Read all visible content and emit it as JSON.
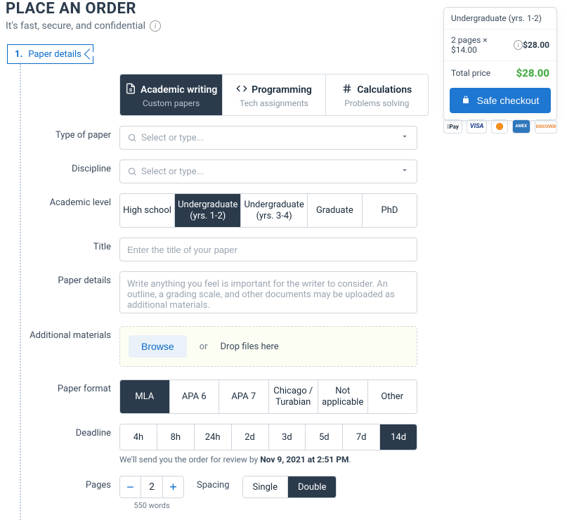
{
  "header": {
    "title": "PLACE AN ORDER",
    "subtitle": "It's fast, secure, and confidential"
  },
  "step": {
    "number": "1.",
    "label": "Paper details"
  },
  "services": [
    {
      "name": "Academic writing",
      "sub": "Custom papers",
      "active": true
    },
    {
      "name": "Programming",
      "sub": "Tech assignments",
      "active": false
    },
    {
      "name": "Calculations",
      "sub": "Problems solving",
      "active": false
    }
  ],
  "labels": {
    "type_of_paper": "Type of paper",
    "discipline": "Discipline",
    "academic_level": "Academic level",
    "title": "Title",
    "paper_details": "Paper details",
    "additional_materials": "Additional materials",
    "paper_format": "Paper format",
    "deadline": "Deadline",
    "pages": "Pages",
    "spacing": "Spacing"
  },
  "placeholders": {
    "select_or_type": "Select or type...",
    "title": "Enter the title of your paper",
    "details": "Write anything you feel is important for the writer to consider. An outline, a grading scale, and other documents may be uploaded as additional materials."
  },
  "academic_levels": [
    "High school",
    "Undergraduate (yrs. 1-2)",
    "Undergraduate (yrs. 3-4)",
    "Graduate",
    "PhD"
  ],
  "academic_levels_active": 1,
  "upload": {
    "browse": "Browse",
    "or": "or",
    "drop": "Drop files here"
  },
  "paper_formats": [
    "MLA",
    "APA 6",
    "APA 7",
    "Chicago / Turabian",
    "Not applicable",
    "Other"
  ],
  "paper_formats_active": 0,
  "deadlines": [
    "4h",
    "8h",
    "24h",
    "2d",
    "3d",
    "5d",
    "7d",
    "14d"
  ],
  "deadlines_active": 7,
  "deadline_note_prefix": "We'll send you the order for review by ",
  "deadline_note_date": "Nov 9, 2021 at 2:51 PM",
  "pages": {
    "value": "2",
    "words": "550 words"
  },
  "spacing": [
    "Single",
    "Double"
  ],
  "spacing_active": 1,
  "summary": {
    "level": "Undergraduate (yrs. 1-2)",
    "calc": "2 pages × $14.00",
    "line_price": "$28.00",
    "total_label": "Total price",
    "total": "$28.00",
    "checkout": "Safe checkout"
  },
  "payment_badges": [
    "ApplePay",
    "VISA",
    "Mastercard",
    "AmEx",
    "Discover"
  ]
}
